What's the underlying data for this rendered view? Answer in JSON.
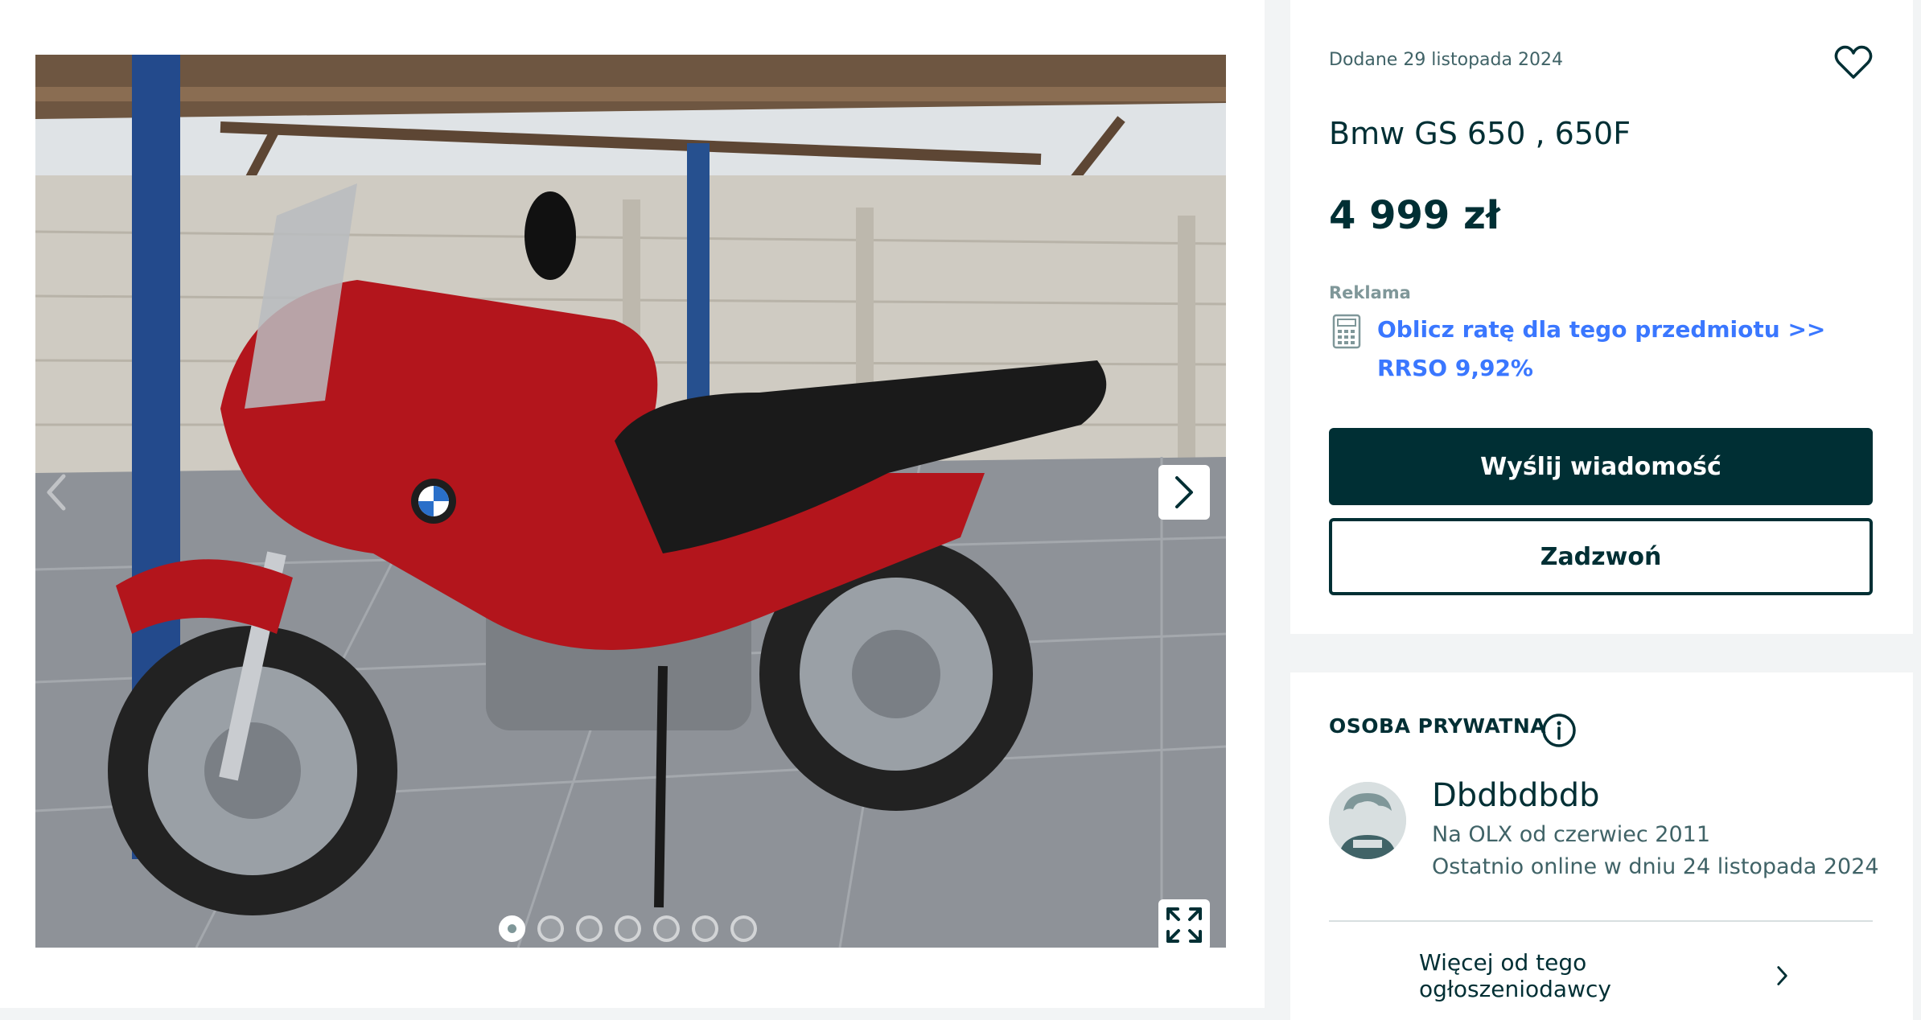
{
  "gallery": {
    "image_alt": "Bmw GS 650 , 650F",
    "dot_count": 7,
    "active_index": 0,
    "icons": {
      "prev": "chevron-left-icon",
      "next": "chevron-right-icon",
      "expand": "expand-icon"
    }
  },
  "listing": {
    "date": "Dodane 29 listopada 2024",
    "title": "Bmw GS 650 , 650F",
    "price": "4 999 zł",
    "ad_label": "Reklama",
    "rate_link": "Oblicz ratę dla tego przedmiotu >> RRSO 9,92%",
    "message_button": "Wyślij wiadomość",
    "call_button": "Zadzwoń",
    "favorite_icon": "heart-icon",
    "calculator_icon": "calculator-icon"
  },
  "seller": {
    "type": "OSOBA PRYWATNA",
    "name": "Dbdbdbdb",
    "since": "Na OLX od czerwiec 2011",
    "last_online": "Ostatnio online w dniu 24 listopada 2024",
    "more_link": "Więcej od tego ogłoszeniodawcy",
    "info_icon": "info-icon",
    "avatar_icon": "default-avatar-icon"
  },
  "colors": {
    "primary": "#002f34",
    "link": "#3a77ff",
    "muted": "#406367",
    "background": "#f2f4f5"
  }
}
